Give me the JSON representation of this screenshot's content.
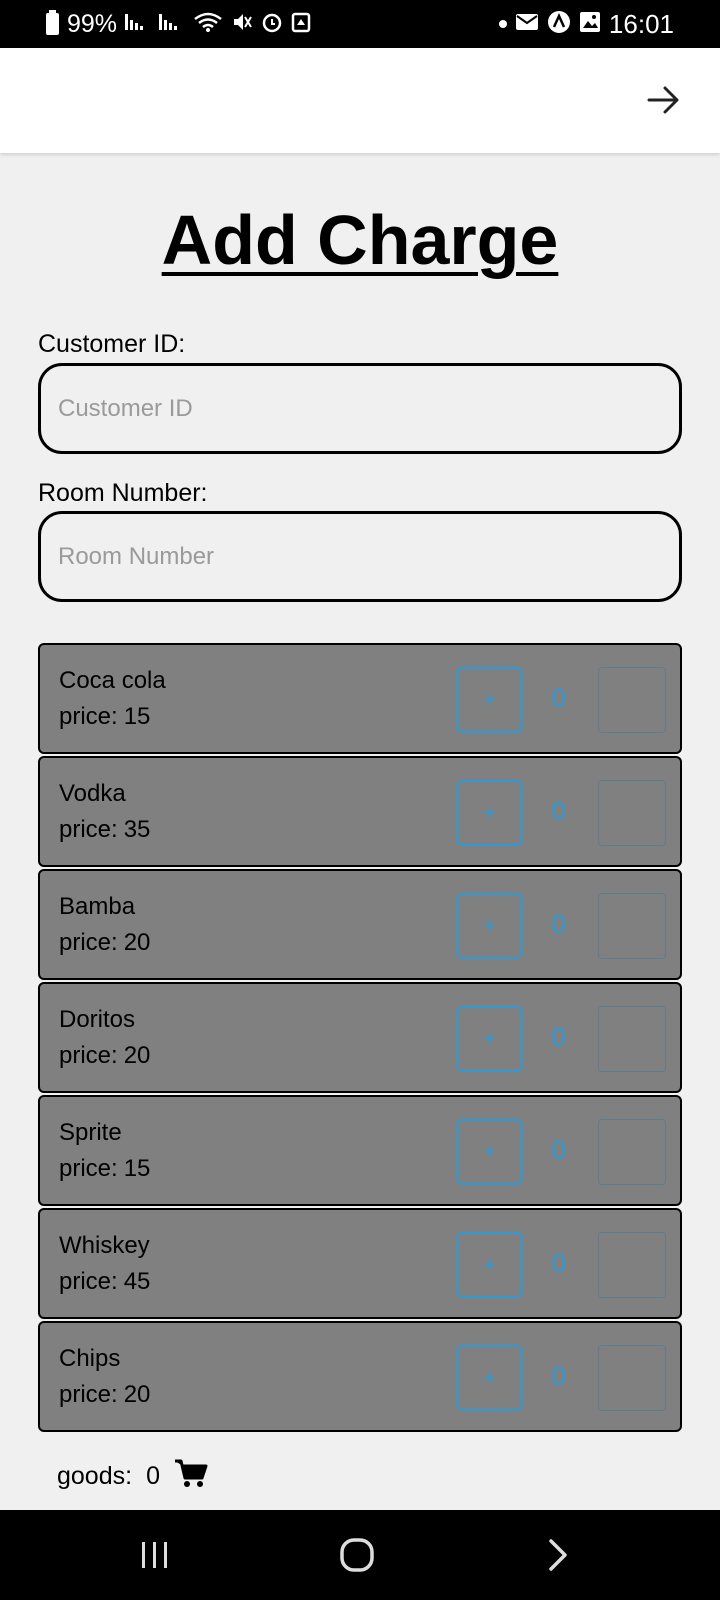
{
  "status_bar": {
    "battery": "99%",
    "time": "16:01"
  },
  "app_bar": {
    "forward_icon": "arrow-right-icon"
  },
  "page": {
    "title": "Add Charge"
  },
  "form": {
    "customer_id_label": "Customer ID:",
    "customer_id_placeholder": "Customer ID",
    "customer_id_value": "",
    "room_number_label": "Room Number:",
    "room_number_placeholder": "Room Number",
    "room_number_value": ""
  },
  "items": [
    {
      "name": "Coca cola",
      "price_label": "price:",
      "price": "15",
      "plus": "+",
      "qty": "0"
    },
    {
      "name": "Vodka",
      "price_label": "price:",
      "price": "35",
      "plus": "+",
      "qty": "0"
    },
    {
      "name": "Bamba",
      "price_label": "price:",
      "price": "20",
      "plus": "+",
      "qty": "0"
    },
    {
      "name": "Doritos",
      "price_label": "price:",
      "price": "20",
      "plus": "+",
      "qty": "0"
    },
    {
      "name": "Sprite",
      "price_label": "price:",
      "price": "15",
      "plus": "+",
      "qty": "0"
    },
    {
      "name": "Whiskey",
      "price_label": "price:",
      "price": "45",
      "plus": "+",
      "qty": "0"
    },
    {
      "name": "Chips",
      "price_label": "price:",
      "price": "20",
      "plus": "+",
      "qty": "0"
    }
  ],
  "summary": {
    "goods_label": "goods:",
    "goods_count": "0"
  },
  "colors": {
    "item_background": "#808080",
    "accent": "#2e9ad6",
    "page_background": "#f0f0f0"
  }
}
